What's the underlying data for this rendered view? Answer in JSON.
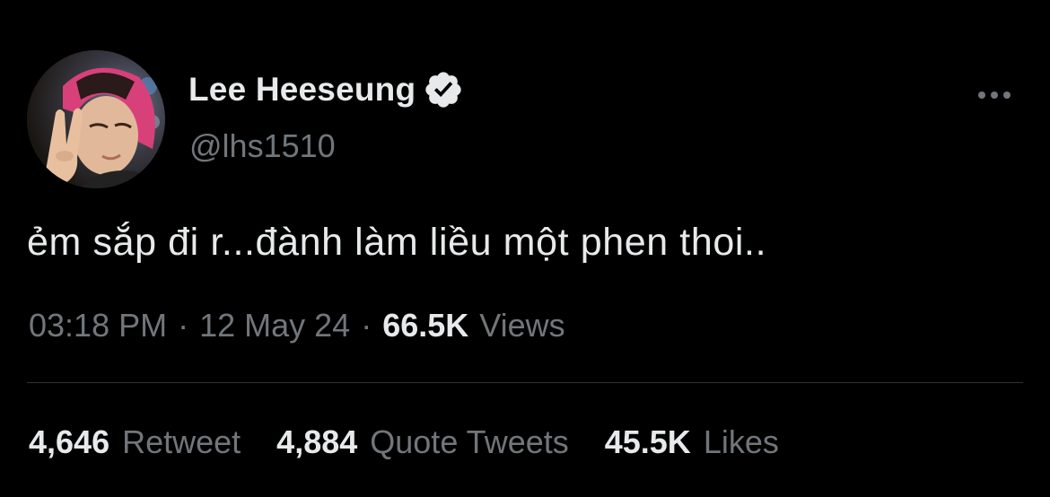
{
  "author": {
    "display_name": "Lee Heeseung",
    "handle": "@lhs1510",
    "verified": true,
    "avatar_icon": "profile-photo"
  },
  "tweet": {
    "text": "ẻm sắp đi r...đành làm liều một phen thoi.."
  },
  "meta": {
    "time": "03:18 PM",
    "separator": "·",
    "date": "12 May 24",
    "views_count": "66.5K",
    "views_label": "Views"
  },
  "stats": {
    "retweets": {
      "count": "4,646",
      "label": "Retweet"
    },
    "quotes": {
      "count": "4,884",
      "label": "Quote Tweets"
    },
    "likes": {
      "count": "45.5K",
      "label": "Likes"
    }
  },
  "icons": {
    "verified": "verified-badge-icon",
    "more": "more-options-icon"
  },
  "colors": {
    "background": "#000000",
    "primary_text": "#e7e9ea",
    "secondary_text": "#71767b",
    "divider": "#2f3336",
    "avatar_hair": "#e0457b"
  }
}
